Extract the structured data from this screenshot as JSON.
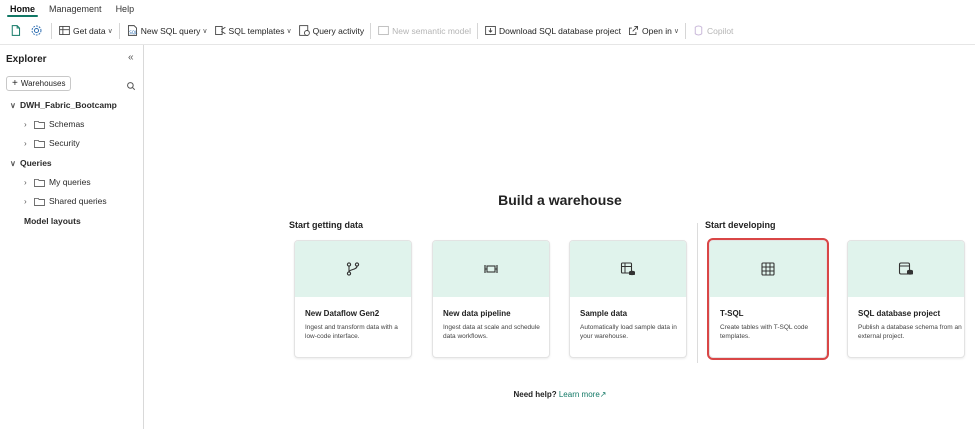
{
  "menu": {
    "tabs": [
      {
        "label": "Home"
      },
      {
        "label": "Management"
      },
      {
        "label": "Help"
      }
    ]
  },
  "ribbon": {
    "get_data": "Get data",
    "new_sql_query": "New SQL query",
    "sql_templates": "SQL templates",
    "query_activity": "Query activity",
    "new_semantic_model": "New semantic model",
    "download_project": "Download SQL database project",
    "open_in": "Open in",
    "copilot": "Copilot"
  },
  "explorer": {
    "title": "Explorer",
    "add_button": "Warehouses",
    "tree": {
      "warehouse": "DWH_Fabric_Bootcamp",
      "schemas": "Schemas",
      "security": "Security",
      "queries": "Queries",
      "my_queries": "My queries",
      "shared_queries": "Shared queries",
      "model_layouts": "Model layouts"
    }
  },
  "main": {
    "title": "Build a warehouse",
    "section_getting_data": "Start getting data",
    "section_developing": "Start developing",
    "cards": [
      {
        "title": "New Dataflow Gen2",
        "desc": "Ingest and transform data with a low-code interface."
      },
      {
        "title": "New data pipeline",
        "desc": "Ingest data at scale and schedule data workflows."
      },
      {
        "title": "Sample data",
        "desc": "Automatically load sample data in your warehouse."
      },
      {
        "title": "T-SQL",
        "desc": "Create tables with T-SQL code templates."
      },
      {
        "title": "SQL database project",
        "desc": "Publish a database schema from an external project."
      }
    ],
    "help_question": "Need help?",
    "help_link": "Learn more"
  },
  "colors": {
    "accent": "#117865",
    "card_header": "#e0f3ec",
    "highlight": "#d94646"
  }
}
